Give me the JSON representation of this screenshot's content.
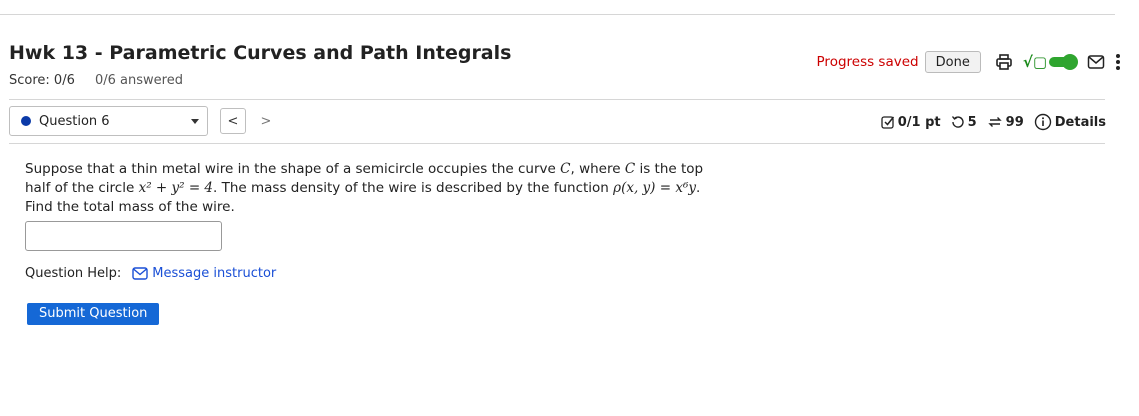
{
  "header": {
    "title": "Hwk 13 - Parametric Curves and Path Integrals",
    "score": "Score: 0/6",
    "answered": "0/6 answered",
    "progress_saved": "Progress saved",
    "done_label": "Done"
  },
  "question_nav": {
    "selected": "Question 6",
    "prev_symbol": "<",
    "next_symbol": ">"
  },
  "meta": {
    "points": "0/1 pt",
    "retries": "5",
    "attempts": "99",
    "details": "Details"
  },
  "question": {
    "t1": "Suppose that a thin metal wire in the shape of a semicircle occupies the curve ",
    "m1": "C",
    "t2": ", where ",
    "m2": "C",
    "t3": " is the top half of the circle ",
    "eq": "x² + y² = 4",
    "t4": ". The mass density of the wire is described by the function ",
    "rho": "ρ(x, y) = x⁶y",
    "t5": ". Find the total mass of the wire."
  },
  "answer": {
    "value": ""
  },
  "help": {
    "label": "Question Help:",
    "message": "Message instructor"
  },
  "submit_label": "Submit Question",
  "colors": {
    "accent": "#1568d6",
    "saved": "#cc0000",
    "toggle": "#2fa52f",
    "link": "#1a4fd6"
  }
}
